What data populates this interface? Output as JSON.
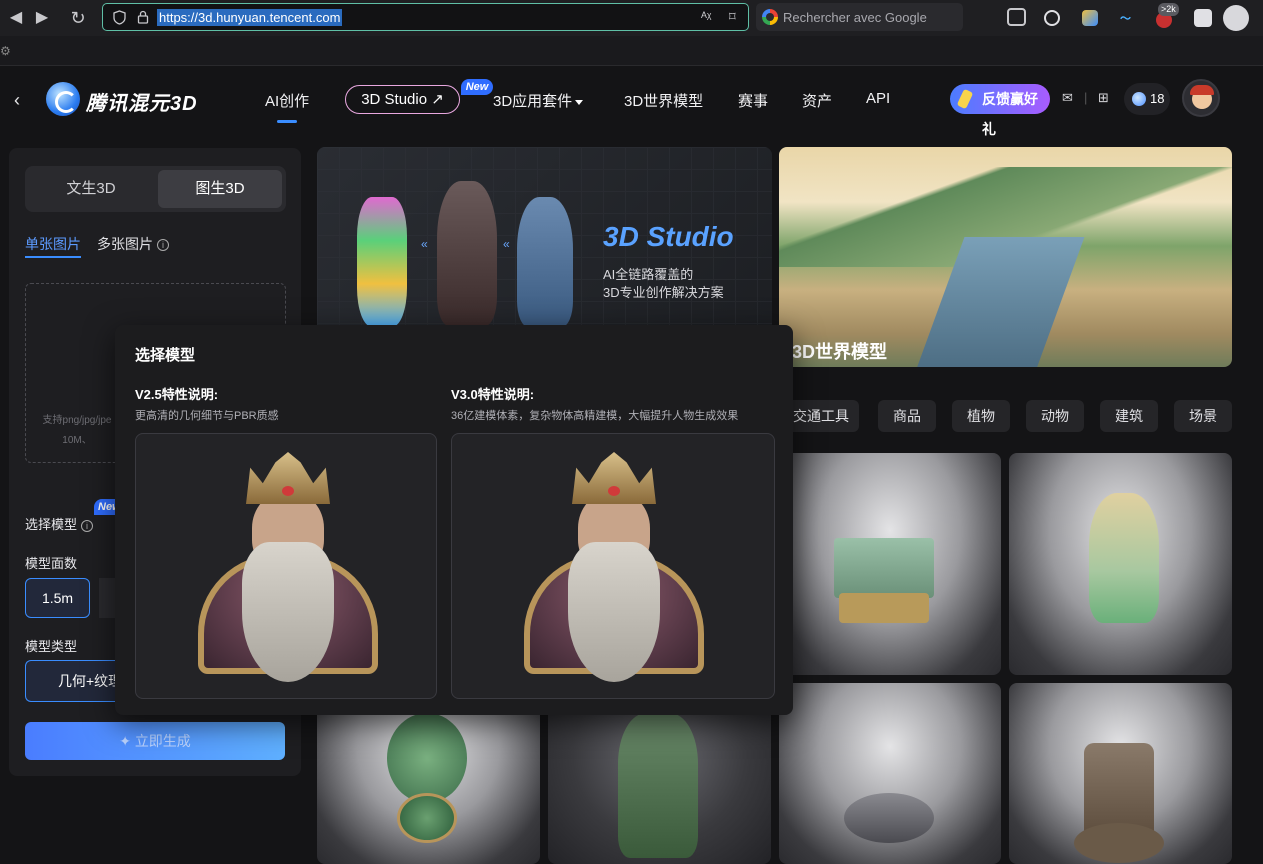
{
  "browser": {
    "url": "https://3d.hunyuan.tencent.com",
    "search_placeholder": "Rechercher avec Google",
    "ext_badge": ">2k"
  },
  "header": {
    "brand": "腾讯混元3D",
    "nav": [
      "AI创作",
      "3D Studio",
      "3D应用套件",
      "3D世界模型",
      "赛事",
      "资产",
      "API"
    ],
    "new_tag": "New",
    "feedback": "反馈赢好礼",
    "points": "18"
  },
  "left": {
    "modes": [
      "文生3D",
      "图生3D"
    ],
    "subtabs": [
      "单张图片",
      "多张图片"
    ],
    "drop_hint_1": "支持png/jpg/jpe",
    "drop_hint_2": "10M、",
    "select_model_label": "选择模型",
    "new_tag": "New",
    "face_label": "模型面数",
    "face_value": "1.5m",
    "type_label": "模型类型",
    "type_value": "几何+纹理",
    "generate": "立即生成"
  },
  "main": {
    "studio_title": "3D Studio",
    "studio_sub_1": "AI全链路覆盖的",
    "studio_sub_2": "3D专业创作解决方案",
    "world_title": "3D世界模型",
    "categories": [
      "交通工具",
      "商品",
      "植物",
      "动物",
      "建筑",
      "场景"
    ]
  },
  "modal": {
    "title": "选择模型",
    "v25_title": "V2.5特性说明:",
    "v25_desc": "更高清的几何细节与PBR质感",
    "v30_title": "V3.0特性说明:",
    "v30_desc": "36亿建模体素，复杂物体高精建模，大幅提升人物生成效果"
  },
  "colors": {
    "accent": "#3a8dff",
    "bg": "#141416",
    "panel": "#1e1e21"
  }
}
